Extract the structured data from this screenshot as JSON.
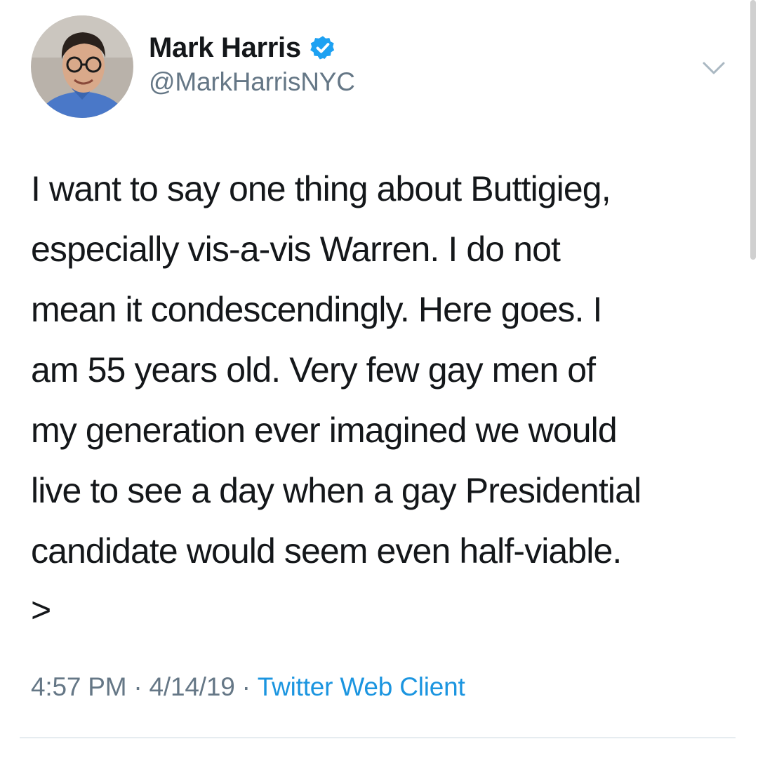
{
  "tweet": {
    "author": {
      "name": "Mark Harris",
      "handle": "@MarkHarrisNYC",
      "verified": true
    },
    "text": "I want to say one thing about Buttigieg,\nespecially vis-a-vis Warren. I do not\nmean it condescendingly. Here goes. I\nam 55 years old. Very few gay men of\nmy generation ever imagined we would\nlive to see a day when a gay Presidential\ncandidate would seem even half-viable.",
    "continuation": ">",
    "time": "4:57 PM",
    "separator": "·",
    "date": "4/14/19",
    "source": "Twitter Web Client"
  },
  "colors": {
    "text": "#14171a",
    "secondary": "#657786",
    "link": "#1b95e0",
    "verified": "#1da1f2",
    "divider": "#e6ecf0"
  },
  "icons": {
    "verified": "verified-badge-icon",
    "menu": "chevron-down-icon"
  }
}
